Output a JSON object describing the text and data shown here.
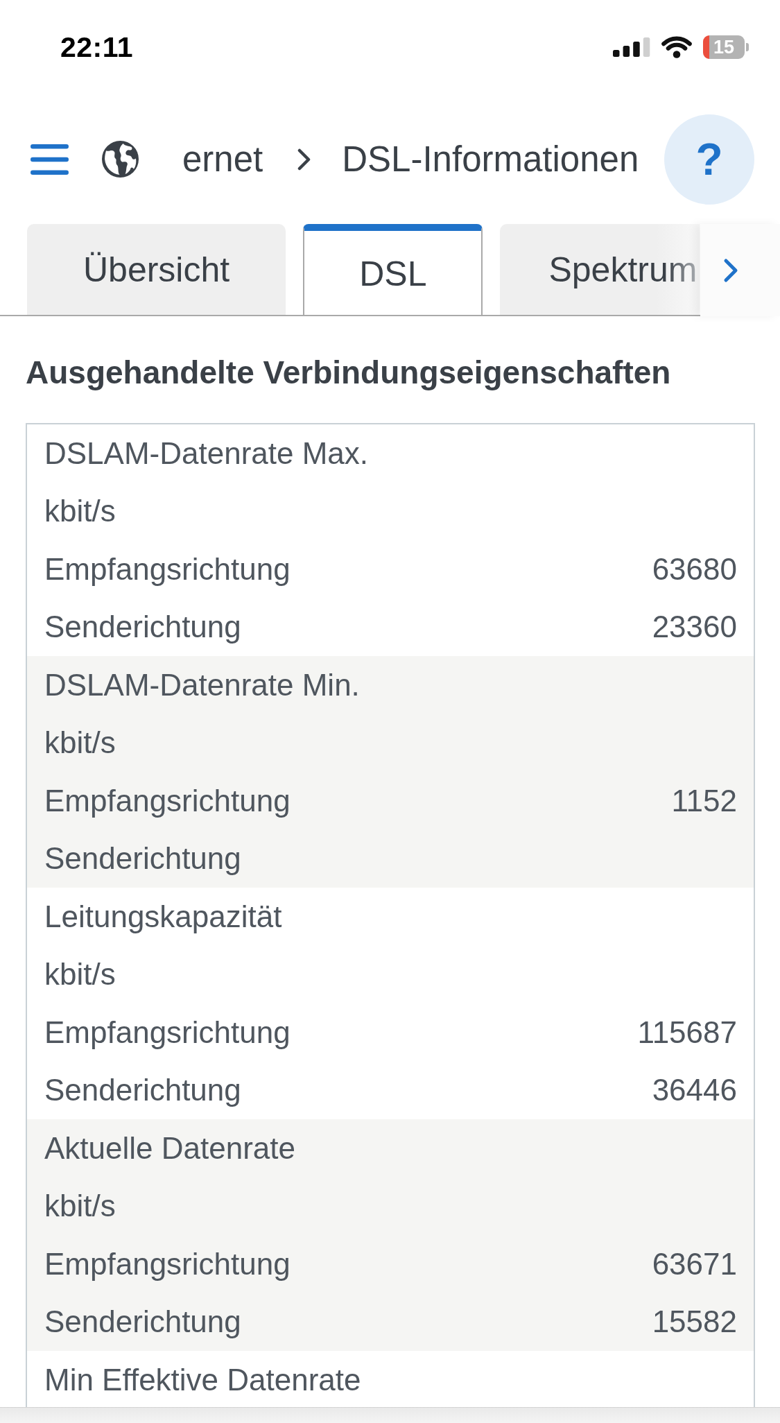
{
  "status_bar": {
    "time": "22:11",
    "battery": "15"
  },
  "header": {
    "breadcrumb": [
      "ernet",
      "DSL-Informationen"
    ],
    "help": "?"
  },
  "tabs": [
    {
      "label": "Übersicht",
      "selected": false
    },
    {
      "label": "DSL",
      "selected": true
    },
    {
      "label": "Spektrum",
      "selected": false
    }
  ],
  "section": {
    "title": "Ausgehandelte Verbindungseigenschaften",
    "groups": [
      {
        "title": "DSLAM-Datenrate Max.",
        "unit": "kbit/s",
        "rows": [
          {
            "label": "Empfangsrichtung",
            "value": "63680"
          },
          {
            "label": "Senderichtung",
            "value": "23360"
          }
        ]
      },
      {
        "title": "DSLAM-Datenrate Min.",
        "unit": "kbit/s",
        "rows": [
          {
            "label": "Empfangsrichtung",
            "value": "1152"
          },
          {
            "label": "Senderichtung"
          }
        ]
      },
      {
        "title": "Leitungskapazität",
        "unit": "kbit/s",
        "rows": [
          {
            "label": "Empfangsrichtung",
            "value": "115687"
          },
          {
            "label": "Senderichtung",
            "value": "36446"
          }
        ]
      },
      {
        "title": "Aktuelle Datenrate",
        "unit": "kbit/s",
        "rows": [
          {
            "label": "Empfangsrichtung",
            "value": "63671"
          },
          {
            "label": "Senderichtung",
            "value": "15582"
          }
        ]
      },
      {
        "title": "Min Effektive Datenrate"
      }
    ]
  }
}
